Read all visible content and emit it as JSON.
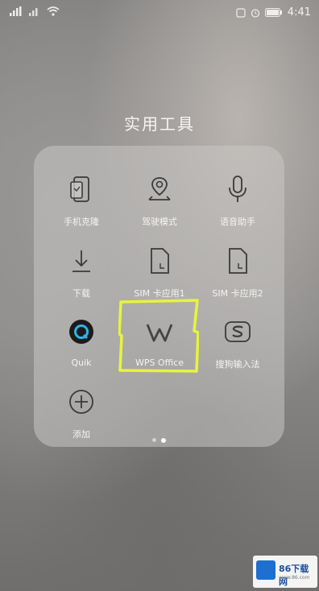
{
  "status_bar": {
    "time": "4:41",
    "battery_icon": "battery-icon",
    "signal_icon": "signal-icon",
    "wifi_icon": "wifi-icon"
  },
  "folder": {
    "title": "实用工具",
    "apps": [
      {
        "label": "手机克隆",
        "icon": "phone-clone-icon"
      },
      {
        "label": "驾驶模式",
        "icon": "drive-mode-icon"
      },
      {
        "label": "语音助手",
        "icon": "microphone-icon"
      },
      {
        "label": "下载",
        "icon": "download-icon"
      },
      {
        "label": "SIM 卡应用1",
        "icon": "sim-card-icon"
      },
      {
        "label": "SIM 卡应用2",
        "icon": "sim-card-icon"
      },
      {
        "label": "Quik",
        "icon": "quik-icon"
      },
      {
        "label": "WPS Office",
        "icon": "wps-office-icon"
      },
      {
        "label": "搜狗输入法",
        "icon": "sogou-input-icon"
      },
      {
        "label": "添加",
        "icon": "add-icon"
      }
    ],
    "page_count": 2,
    "current_page": 2
  },
  "highlight_color": "#e6f53a",
  "watermark": {
    "text": "86下载网",
    "sub": "www.86.com"
  }
}
